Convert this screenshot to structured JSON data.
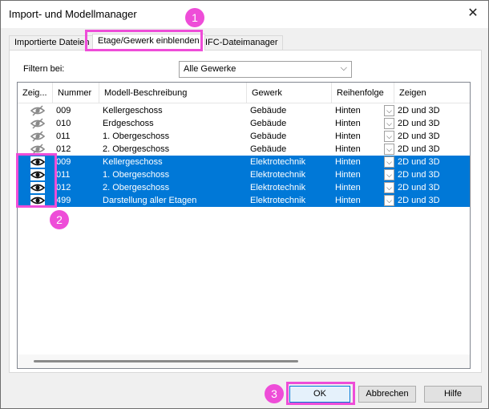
{
  "window": {
    "title": "Import- und Modellmanager"
  },
  "tabs": [
    {
      "label": "Importierte Dateien"
    },
    {
      "label": "Etage/Gewerk einblenden"
    },
    {
      "label": "IFC-Dateimanager"
    }
  ],
  "filter": {
    "label": "Filtern bei:",
    "value": "Alle Gewerke"
  },
  "columns": [
    "Zeig...",
    "Nummer",
    "Modell-Beschreibung",
    "Gewerk",
    "Reihenfolge",
    "Zeigen"
  ],
  "rows": [
    {
      "visible": false,
      "nummer": "009",
      "beschreibung": "Kellergeschoss",
      "gewerk": "Gebäude",
      "reihenfolge": "Hinten",
      "zeigen": "2D und 3D",
      "selected": false
    },
    {
      "visible": false,
      "nummer": "010",
      "beschreibung": "Erdgeschoss",
      "gewerk": "Gebäude",
      "reihenfolge": "Hinten",
      "zeigen": "2D und 3D",
      "selected": false
    },
    {
      "visible": false,
      "nummer": "011",
      "beschreibung": "1. Obergeschoss",
      "gewerk": "Gebäude",
      "reihenfolge": "Hinten",
      "zeigen": "2D und 3D",
      "selected": false
    },
    {
      "visible": false,
      "nummer": "012",
      "beschreibung": "2. Obergeschoss",
      "gewerk": "Gebäude",
      "reihenfolge": "Hinten",
      "zeigen": "2D und 3D",
      "selected": false
    },
    {
      "visible": true,
      "nummer": "009",
      "beschreibung": "Kellergeschoss",
      "gewerk": "Elektrotechnik",
      "reihenfolge": "Hinten",
      "zeigen": "2D und 3D",
      "selected": true
    },
    {
      "visible": true,
      "nummer": "011",
      "beschreibung": "1. Obergeschoss",
      "gewerk": "Elektrotechnik",
      "reihenfolge": "Hinten",
      "zeigen": "2D und 3D",
      "selected": true
    },
    {
      "visible": true,
      "nummer": "012",
      "beschreibung": "2. Obergeschoss",
      "gewerk": "Elektrotechnik",
      "reihenfolge": "Hinten",
      "zeigen": "2D und 3D",
      "selected": true
    },
    {
      "visible": true,
      "nummer": "499",
      "beschreibung": "Darstellung aller Etagen",
      "gewerk": "Elektrotechnik",
      "reihenfolge": "Hinten",
      "zeigen": "2D und 3D",
      "selected": true
    }
  ],
  "buttons": {
    "ok": "OK",
    "cancel": "Abbrechen",
    "help": "Hilfe"
  },
  "callouts": [
    "1",
    "2",
    "3"
  ],
  "colors": {
    "selection": "#0078d7",
    "highlight": "#ee4dd8"
  },
  "icons": {
    "close": "close-icon",
    "eye": "eye-icon",
    "eye_hidden": "eye-slash-icon",
    "chevron": "chevron-down-icon"
  }
}
